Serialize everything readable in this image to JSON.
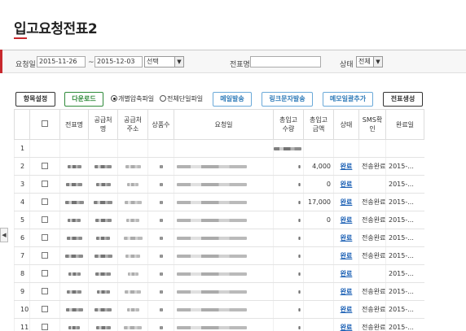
{
  "page": {
    "title": "입고요청전표2"
  },
  "filter": {
    "date_label": "요청일",
    "date_from": "2015-11-26",
    "tilde": "~",
    "date_to": "2015-12-03",
    "select_value": "선택",
    "slip_label": "전표명",
    "slip_value": "",
    "status_label": "상태",
    "status_value": "전체"
  },
  "toolbar": {
    "settings": "항목설정",
    "download": "다운로드",
    "radio_individual": "개별압축파일",
    "radio_whole": "전체단일파일",
    "mail": "메일발송",
    "link_sms": "링크문자발송",
    "memo": "메모일괄추가",
    "create": "전표생성"
  },
  "table": {
    "headers": [
      "",
      "",
      "전표명",
      "공급처\n명",
      "공급처\n주소",
      "상품수",
      "요청일",
      "총입고\n수량",
      "총입고\n금액",
      "상태",
      "SMS확\n인",
      "완료일"
    ],
    "rows": [
      {
        "no": "1",
        "status": "",
        "sms": "",
        "done": ""
      },
      {
        "no": "2",
        "amount": "4,000",
        "status": "완료",
        "sms": "전송완료",
        "done": "2015-..."
      },
      {
        "no": "3",
        "amount": "0",
        "status": "완료",
        "sms": "",
        "done": "2015-..."
      },
      {
        "no": "4",
        "amount": "17,000",
        "status": "완료",
        "sms": "전송완료",
        "done": "2015-..."
      },
      {
        "no": "5",
        "amount": "0",
        "status": "완료",
        "sms": "전송완료",
        "done": "2015-..."
      },
      {
        "no": "6",
        "amount": "",
        "status": "완료",
        "sms": "전송완료",
        "done": "2015-..."
      },
      {
        "no": "7",
        "amount": "",
        "status": "완료",
        "sms": "전송완료",
        "done": "2015-..."
      },
      {
        "no": "8",
        "amount": "",
        "status": "완료",
        "sms": "",
        "done": "2015-..."
      },
      {
        "no": "9",
        "amount": "",
        "status": "완료",
        "sms": "전송완료",
        "done": "2015-..."
      },
      {
        "no": "10",
        "amount": "",
        "status": "완료",
        "sms": "전송완료",
        "done": "2015-..."
      },
      {
        "no": "11",
        "amount": "",
        "status": "완료",
        "sms": "전송완료",
        "done": "2015-..."
      }
    ]
  },
  "side_tab": "◀",
  "colors": {
    "accent": "#c8282d",
    "link": "#1a5fb4",
    "green": "#2f8a3a"
  }
}
